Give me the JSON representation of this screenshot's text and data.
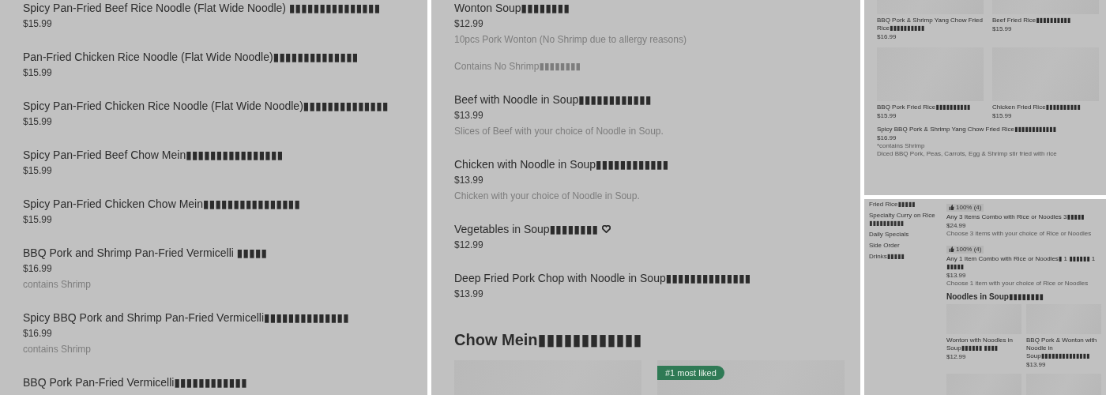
{
  "panels": [
    {
      "kind": "list",
      "items": [
        {
          "name": "Spicy Pan-Fried Beef Rice Noodle (Flat Wide Noodle) ▮▮▮▮▮▮▮▮▮▮▮▮▮▮▮",
          "price": "$15.99"
        },
        {
          "name": "Pan-Fried Chicken Rice Noodle (Flat Wide Noodle)▮▮▮▮▮▮▮▮▮▮▮▮▮▮",
          "price": "$15.99"
        },
        {
          "name": "Spicy Pan-Fried Chicken Rice Noodle (Flat Wide Noodle)▮▮▮▮▮▮▮▮▮▮▮▮▮▮",
          "price": "$15.99"
        },
        {
          "name": "Spicy Pan-Fried Beef Chow Mein▮▮▮▮▮▮▮▮▮▮▮▮▮▮▮▮",
          "price": "$15.99"
        },
        {
          "name": "Spicy Pan-Fried Chicken Chow Mein▮▮▮▮▮▮▮▮▮▮▮▮▮▮▮▮",
          "price": "$15.99"
        },
        {
          "name": "BBQ Pork and Shrimp Pan-Fried Vermicelli ▮▮▮▮▮",
          "price": "$16.99",
          "notes": [
            "contains Shrimp"
          ]
        },
        {
          "name": "Spicy BBQ Pork and Shrimp Pan-Fried Vermicelli▮▮▮▮▮▮▮▮▮▮▮▮▮▮",
          "price": "$16.99",
          "notes": [
            "contains Shrimp"
          ]
        },
        {
          "name": "BBQ Pork Pan-Fried Vermicelli▮▮▮▮▮▮▮▮▮▮▮▮"
        }
      ]
    },
    {
      "kind": "list",
      "items": [
        {
          "name": "Wonton Soup▮▮▮▮▮▮▮▮",
          "price": "$12.99",
          "notes": [
            "10pcs Pork Wonton (No Shrimp due to allergy reasons)",
            "Contains No Shrimp▮▮▮▮▮▮▮▮"
          ]
        },
        {
          "name": "Beef with Noodle in Soup▮▮▮▮▮▮▮▮▮▮▮▮",
          "price": "$13.99",
          "notes": [
            "Slices of Beef with your choice of Noodle in Soup."
          ]
        },
        {
          "name": "Chicken with Noodle in Soup▮▮▮▮▮▮▮▮▮▮▮▮",
          "price": "$13.99",
          "notes": [
            "Chicken with your choice of Noodle in Soup."
          ]
        },
        {
          "name": "Vegetables in Soup▮▮▮▮▮▮▮▮",
          "heart": true,
          "price": "$12.99"
        },
        {
          "name": "Deep Fried Pork Chop with Noodle in Soup▮▮▮▮▮▮▮▮▮▮▮▮▮▮",
          "price": "$13.99"
        }
      ],
      "section": {
        "title": "Chow Mein▮▮▮▮▮▮▮▮▮▮▮▮",
        "cards": [
          {
            "kind": "picture"
          },
          {
            "kind": "picture",
            "badge": "#1 most liked"
          }
        ]
      }
    },
    {
      "kind": "grid",
      "cards": [
        {
          "kind": "picture",
          "name": "BBQ Pork & Shrimp Yang Chow Fried Rice▮▮▮▮▮▮▮▮▮▮",
          "price": "$16.99"
        },
        {
          "kind": "picture",
          "name": "Beef Fried Rice▮▮▮▮▮▮▮▮▮▮",
          "price": "$15.99"
        },
        {
          "kind": "picture",
          "name": "BBQ Pork Fried Rice▮▮▮▮▮▮▮▮▮▮",
          "price": "$15.99"
        },
        {
          "kind": "picture",
          "name": "Chicken Fried Rice▮▮▮▮▮▮▮▮▮▮",
          "price": "$15.99"
        }
      ],
      "items": [
        {
          "name": "Spicy BBQ Pork & Shrimp Yang Chow Fried Rice▮▮▮▮▮▮▮▮▮▮▮▮",
          "price": "$16.99",
          "notes": [
            "*contains Shrimp",
            "Diced BBQ Pork, Peas, Carrots, Egg & Shrimp stir fried with rice"
          ]
        }
      ]
    },
    {
      "kind": "menu",
      "sidebar": {
        "items": [
          "Fried Rice▮▮▮▮▮",
          "Specialty Curry on Rice ▮▮▮▮▮▮▮▮▮▮",
          "Daily Specials",
          "Side Order",
          "Drinks▮▮▮▮▮"
        ]
      },
      "items": [
        {
          "badge": "100% (4)",
          "name": "Any 3 Items Combo with Rice or Noodles 3▮▮▮▮▮",
          "price": "$24.99",
          "notes": [
            "Choose 3 items with your choice of Rice or Noodles"
          ]
        },
        {
          "badge": "100% (4)",
          "name": "Any 1 Item Combo with Rice or Noodles▮ 1 ▮▮▮▮▮▮ 1 ▮▮▮▮▮",
          "price": "$13.99",
          "notes": [
            "Choose 1 item with your choice of Rice or Noodles"
          ]
        }
      ],
      "section": {
        "title": "Noodles in Soup▮▮▮▮▮▮▮▮",
        "cards": [
          {
            "kind": "picture",
            "name": "Wonton with Noodles in Soup▮▮▮▮▮▮ ▮▮▮▮",
            "price": "$12.99"
          },
          {
            "kind": "picture",
            "name": "BBQ Pork & Wonton with Noodle in Soup▮▮▮▮▮▮▮▮▮▮▮▮▮▮",
            "price": "$13.99"
          },
          {
            "kind": "picture"
          },
          {
            "kind": "picture"
          }
        ]
      }
    }
  ]
}
